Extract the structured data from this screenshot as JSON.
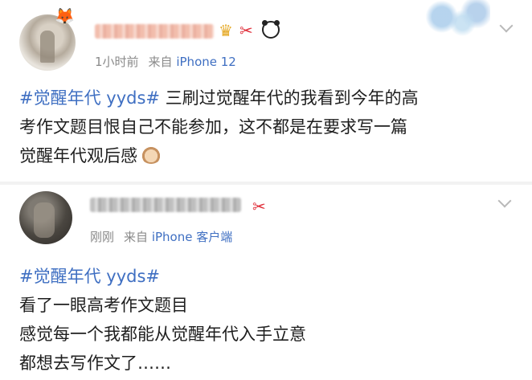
{
  "posts": [
    {
      "time": "1小时前",
      "from_label": "来自",
      "device": "iPhone 12",
      "topic": "#觉醒年代 yyds#",
      "body_lines": [
        "三刷过觉醒年代的我看到今年的高",
        "考作文题目恨自己不能参加，这不都是在要求写一篇",
        "觉醒年代观后感"
      ],
      "icons": [
        "fox-badge-icon",
        "crown-icon",
        "gift-icon",
        "panda-icon",
        "cat-emoji-icon",
        "chevron-down-icon"
      ]
    },
    {
      "time": "刚刚",
      "from_label": "来自",
      "device": "iPhone 客户端",
      "topic": "#觉醒年代 yyds#",
      "body_lines": [
        "看了一眼高考作文题目",
        "感觉每一个我都能从觉醒年代入手立意",
        "都想去写作文了……"
      ],
      "icons": [
        "gift-icon",
        "chevron-down-icon"
      ]
    }
  ],
  "colors": {
    "link": "#3f6fc2",
    "meta": "#8a8a8a",
    "text": "#1e1e1e"
  }
}
